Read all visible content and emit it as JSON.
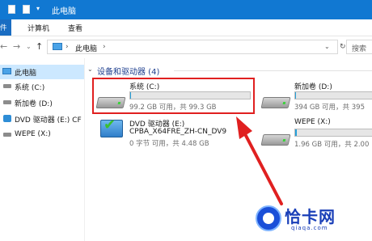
{
  "window": {
    "title": "此电脑"
  },
  "ribbon": {
    "tabs": [
      "件",
      "计算机",
      "查看"
    ]
  },
  "nav": {
    "address_path": "此电脑",
    "address_separator": "›",
    "search_placeholder": "搜索"
  },
  "sidebar": {
    "items": [
      {
        "label": "此电脑",
        "icon": "pc-icon",
        "selected": true
      },
      {
        "label": "系统 (C:)",
        "icon": "drive-icon"
      },
      {
        "label": "新加卷 (D:)",
        "icon": "drive-icon"
      },
      {
        "label": "DVD 驱动器 (E:) CF",
        "icon": "dvd-icon"
      },
      {
        "label": "WEPE (X:)",
        "icon": "drive-icon"
      }
    ]
  },
  "group": {
    "title": "设备和驱动器 (4)"
  },
  "drives": [
    {
      "name": "系统 (C:)",
      "info": "99.2 GB 可用，共 99.3 GB",
      "used_fraction": 0.01
    },
    {
      "name": "新加卷 (D:)",
      "info": "394 GB 可用，共 395",
      "used_fraction": 0.01
    },
    {
      "name": "DVD 驱动器 (E:)",
      "name2": "CPBA_X64FRE_ZH-CN_DV9",
      "info": "0 字节 可用，共 4.48 GB"
    },
    {
      "name": "WEPE (X:)",
      "info": "1.96 GB 可用，共 2.00",
      "used_fraction": 0.02
    }
  ],
  "watermark": {
    "name": "恰卡网",
    "domain": "qiaqa.com"
  },
  "colors": {
    "titlebar": "#1178d2",
    "highlight_box": "#e02020",
    "arrow": "#e02020",
    "bar_fill": "#26a0da"
  }
}
